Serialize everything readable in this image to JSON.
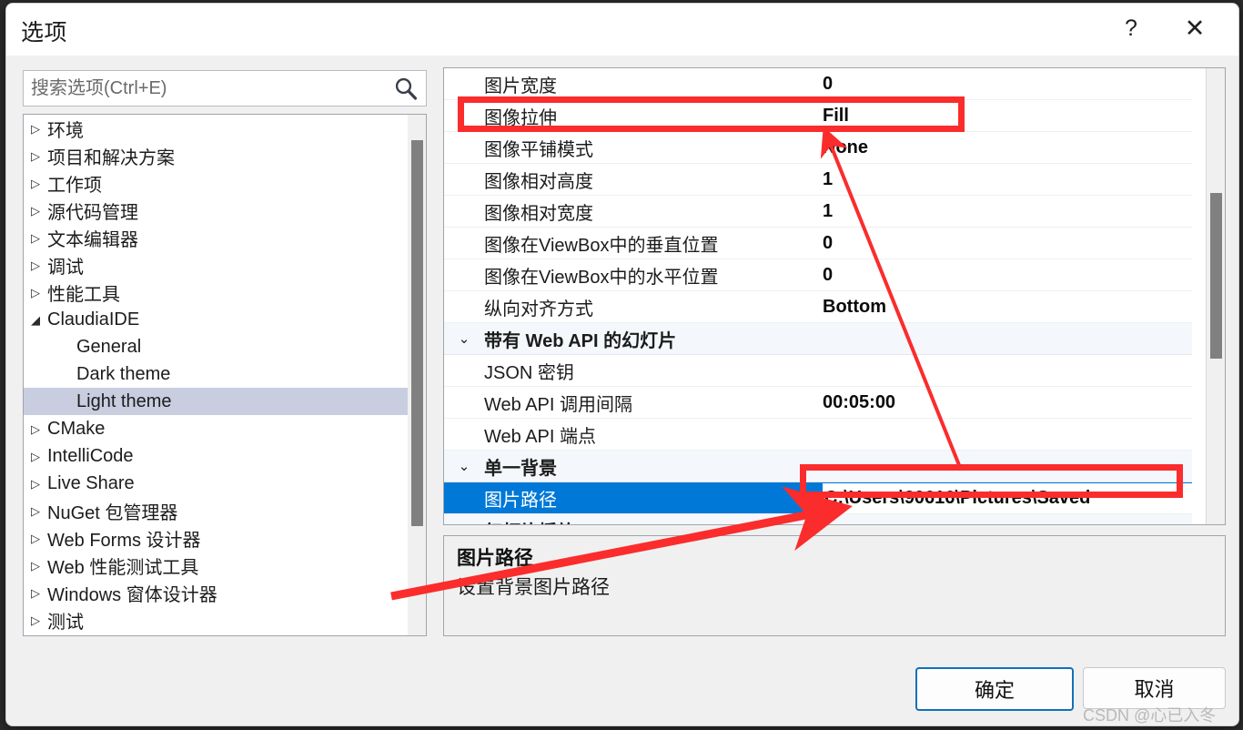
{
  "window": {
    "title": "选项",
    "help_label": "?",
    "close_label": "✕"
  },
  "search": {
    "placeholder": "搜索选项(Ctrl+E)",
    "value": "",
    "icon": "search-icon"
  },
  "tree": {
    "items": [
      {
        "label": "环境",
        "level": 0,
        "expandable": true,
        "expanded": false,
        "selected": false
      },
      {
        "label": "项目和解决方案",
        "level": 0,
        "expandable": true,
        "expanded": false,
        "selected": false
      },
      {
        "label": "工作项",
        "level": 0,
        "expandable": true,
        "expanded": false,
        "selected": false
      },
      {
        "label": "源代码管理",
        "level": 0,
        "expandable": true,
        "expanded": false,
        "selected": false
      },
      {
        "label": "文本编辑器",
        "level": 0,
        "expandable": true,
        "expanded": false,
        "selected": false
      },
      {
        "label": "调试",
        "level": 0,
        "expandable": true,
        "expanded": false,
        "selected": false
      },
      {
        "label": "性能工具",
        "level": 0,
        "expandable": true,
        "expanded": false,
        "selected": false
      },
      {
        "label": "ClaudiaIDE",
        "level": 0,
        "expandable": true,
        "expanded": true,
        "selected": false
      },
      {
        "label": "General",
        "level": 1,
        "expandable": false,
        "expanded": false,
        "selected": false
      },
      {
        "label": "Dark theme",
        "level": 1,
        "expandable": false,
        "expanded": false,
        "selected": false
      },
      {
        "label": "Light theme",
        "level": 1,
        "expandable": false,
        "expanded": false,
        "selected": true
      },
      {
        "label": "CMake",
        "level": 0,
        "expandable": true,
        "expanded": false,
        "selected": false
      },
      {
        "label": "IntelliCode",
        "level": 0,
        "expandable": true,
        "expanded": false,
        "selected": false
      },
      {
        "label": "Live Share",
        "level": 0,
        "expandable": true,
        "expanded": false,
        "selected": false
      },
      {
        "label": "NuGet 包管理器",
        "level": 0,
        "expandable": true,
        "expanded": false,
        "selected": false
      },
      {
        "label": "Web Forms 设计器",
        "level": 0,
        "expandable": true,
        "expanded": false,
        "selected": false
      },
      {
        "label": "Web 性能测试工具",
        "level": 0,
        "expandable": true,
        "expanded": false,
        "selected": false
      },
      {
        "label": "Windows 窗体设计器",
        "level": 0,
        "expandable": true,
        "expanded": false,
        "selected": false
      },
      {
        "label": "测试",
        "level": 0,
        "expandable": true,
        "expanded": false,
        "selected": false
      }
    ],
    "collapsed_glyph": "▷",
    "expanded_glyph": "◢"
  },
  "grid": {
    "rows": [
      {
        "name": "图片宽度",
        "value": "0",
        "kind": "property",
        "selected": false
      },
      {
        "name": "图像拉伸",
        "value": "Fill",
        "kind": "property",
        "selected": false
      },
      {
        "name": "图像平铺模式",
        "value": "None",
        "kind": "property",
        "selected": false
      },
      {
        "name": "图像相对高度",
        "value": "1",
        "kind": "property",
        "selected": false
      },
      {
        "name": "图像相对宽度",
        "value": "1",
        "kind": "property",
        "selected": false
      },
      {
        "name": "图像在ViewBox中的垂直位置",
        "value": "0",
        "kind": "property",
        "selected": false
      },
      {
        "name": "图像在ViewBox中的水平位置",
        "value": "0",
        "kind": "property",
        "selected": false
      },
      {
        "name": "纵向对齐方式",
        "value": "Bottom",
        "kind": "property",
        "selected": false
      },
      {
        "name": "带有 Web API 的幻灯片",
        "value": "",
        "kind": "category",
        "glyph": "⌄",
        "selected": false
      },
      {
        "name": "JSON 密钥",
        "value": "",
        "kind": "property",
        "selected": false
      },
      {
        "name": "Web API 调用间隔",
        "value": "00:05:00",
        "kind": "property",
        "selected": false
      },
      {
        "name": "Web API 端点",
        "value": "",
        "kind": "property",
        "selected": false
      },
      {
        "name": "单一背景",
        "value": "",
        "kind": "category",
        "glyph": "⌄",
        "selected": false
      },
      {
        "name": "图片路径",
        "value": "C:\\Users\\90616\\Pictures\\Saved",
        "kind": "property",
        "selected": true,
        "editing": true,
        "browse_label": ""
      },
      {
        "name": "幻灯片播放",
        "value": "",
        "kind": "category",
        "glyph": "⌄",
        "selected": false
      }
    ]
  },
  "description": {
    "title": "图片路径",
    "text": "设置背景图片路径"
  },
  "footer": {
    "ok_label": "确定",
    "cancel_label": "取消"
  },
  "watermark": {
    "text": "CSDN @心已入冬"
  },
  "colors": {
    "accent_selection": "#0078d7",
    "tree_selection": "#c9cde0",
    "annotation_red": "#fb2c2c",
    "primary_button_border": "#0f71b8"
  }
}
